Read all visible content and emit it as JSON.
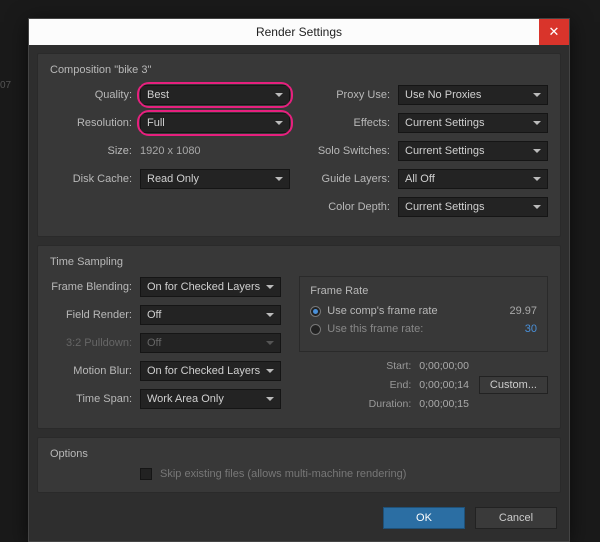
{
  "backdrop": {
    "num": "07"
  },
  "titlebar": {
    "title": "Render Settings",
    "close": "✕"
  },
  "composition": {
    "heading": "Composition \"bike 3\"",
    "left": {
      "quality_label": "Quality:",
      "quality_value": "Best",
      "resolution_label": "Resolution:",
      "resolution_value": "Full",
      "size_label": "Size:",
      "size_value": "1920 x 1080",
      "diskcache_label": "Disk Cache:",
      "diskcache_value": "Read Only"
    },
    "right": {
      "proxy_label": "Proxy Use:",
      "proxy_value": "Use No Proxies",
      "effects_label": "Effects:",
      "effects_value": "Current Settings",
      "solo_label": "Solo Switches:",
      "solo_value": "Current Settings",
      "guide_label": "Guide Layers:",
      "guide_value": "All Off",
      "depth_label": "Color Depth:",
      "depth_value": "Current Settings"
    }
  },
  "timesampling": {
    "heading": "Time Sampling",
    "frameblend_label": "Frame Blending:",
    "frameblend_value": "On for Checked Layers",
    "fieldrender_label": "Field Render:",
    "fieldrender_value": "Off",
    "pulldown_label": "3:2 Pulldown:",
    "pulldown_value": "Off",
    "motionblur_label": "Motion Blur:",
    "motionblur_value": "On for Checked Layers",
    "timespan_label": "Time Span:",
    "timespan_value": "Work Area Only"
  },
  "framerate": {
    "heading": "Frame Rate",
    "usecomp_label": "Use comp's frame rate",
    "usecomp_value": "29.97",
    "usethis_label": "Use this frame rate:",
    "usethis_value": "30"
  },
  "timing": {
    "start_label": "Start:",
    "start_value": "0;00;00;00",
    "end_label": "End:",
    "end_value": "0;00;00;14",
    "duration_label": "Duration:",
    "duration_value": "0;00;00;15",
    "custom": "Custom..."
  },
  "options": {
    "heading": "Options",
    "skip_label": "Skip existing files (allows multi-machine rendering)"
  },
  "footer": {
    "ok": "OK",
    "cancel": "Cancel"
  }
}
